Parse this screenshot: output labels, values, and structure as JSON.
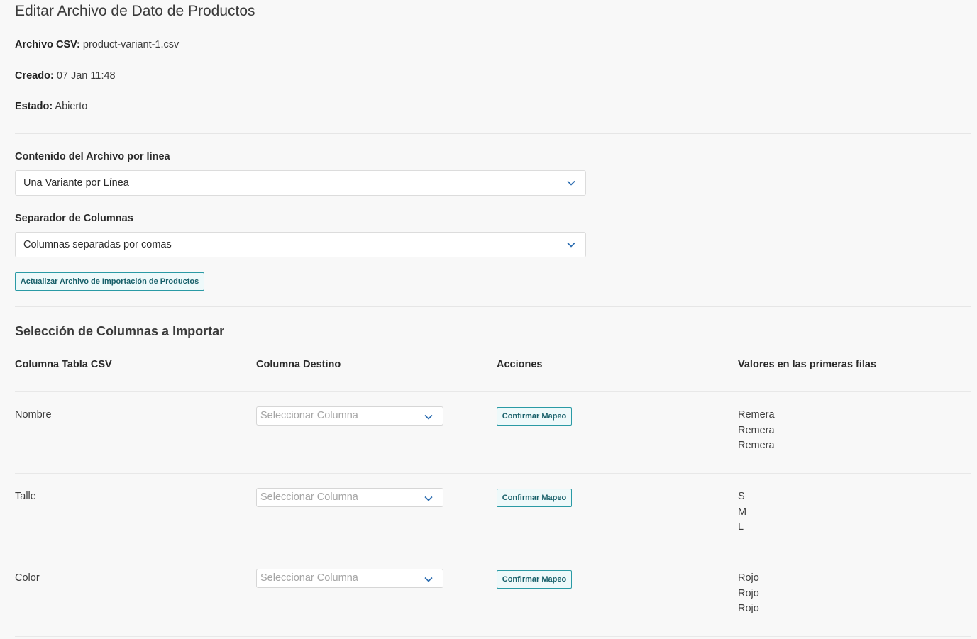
{
  "title": "Editar Archivo de Dato de Productos",
  "meta": {
    "csv_label": "Archivo CSV:",
    "csv_value": "product-variant-1.csv",
    "created_label": "Creado:",
    "created_value": "07 Jan 11:48",
    "status_label": "Estado:",
    "status_value": "Abierto"
  },
  "content_per_line": {
    "label": "Contenido del Archivo por línea",
    "value": "Una Variante por Línea"
  },
  "separator": {
    "label": "Separador de Columnas",
    "value": "Columnas separadas por comas"
  },
  "update_button": "Actualizar Archivo de Importación de Productos",
  "mapping": {
    "title": "Selección de Columnas a Importar",
    "headers": [
      "Columna Tabla CSV",
      "Columna Destino",
      "Acciones",
      "Valores en las primeras filas"
    ],
    "select_placeholder": "Seleccionar Columna",
    "confirm_label": "Confirmar Mapeo",
    "rows": [
      {
        "name": "Nombre",
        "values": [
          "Remera",
          "Remera",
          "Remera"
        ]
      },
      {
        "name": "Talle",
        "values": [
          "S",
          "M",
          "L"
        ]
      },
      {
        "name": "Color",
        "values": [
          "Rojo",
          "Rojo",
          "Rojo"
        ]
      }
    ]
  },
  "colors": {
    "accent": "#2a9aa5",
    "accent_text": "#175f69",
    "chevron": "#2b6cb0",
    "background": "#f8f8f8"
  }
}
